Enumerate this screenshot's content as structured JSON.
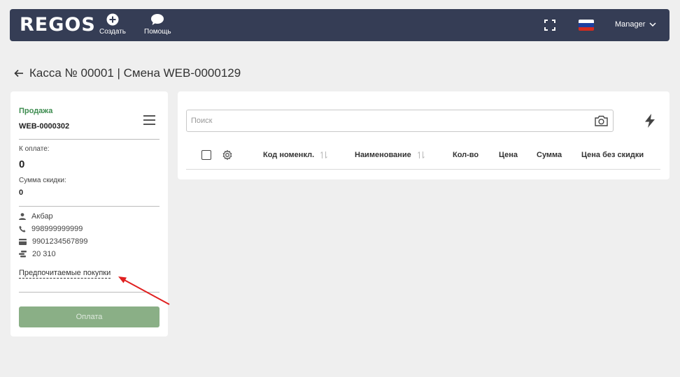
{
  "header": {
    "logo": "REGOS",
    "create_label": "Создать",
    "help_label": "Помощь",
    "user": "Manager",
    "flag_colors": [
      "#ffffff",
      "#1c3fa0",
      "#d52b1e"
    ]
  },
  "page": {
    "title": "Касса № 00001 | Смена WEB-0000129"
  },
  "left_panel": {
    "sale_label": "Продажа",
    "doc_number": "WEB-0000302",
    "to_pay_label": "К оплате:",
    "to_pay_value": "0",
    "discount_label": "Сумма скидки:",
    "discount_value": "0",
    "customer": {
      "name": "Акбар",
      "phone": "998999999999",
      "card": "9901234567899",
      "bonus": "20 310"
    },
    "preferred_link": "Предпочитаемые покупки",
    "pay_button": "Оплата"
  },
  "main_panel": {
    "search_placeholder": "Поиск",
    "columns": [
      "Код номенкл.",
      "Наименование",
      "Кол-во",
      "Цена",
      "Сумма",
      "Цена без скидки"
    ]
  },
  "colors": {
    "header_bg": "#353d55",
    "accent_green": "#3d8c4f",
    "pay_button_bg": "#8aaf86",
    "annotation_arrow": "#e02020"
  }
}
